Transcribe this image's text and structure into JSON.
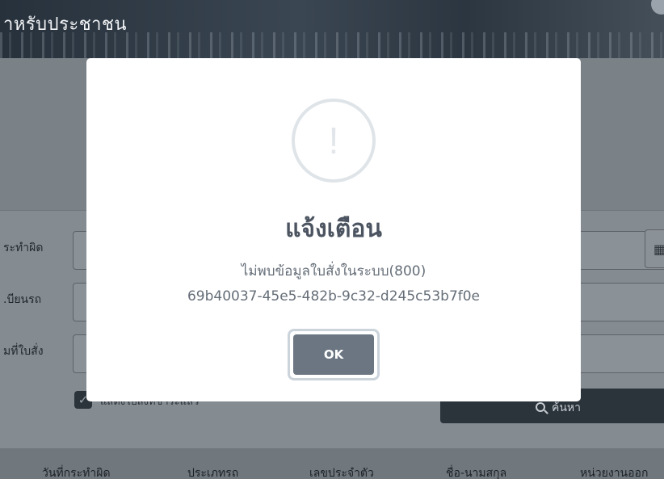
{
  "header": {
    "title": "าหรับประชาชน"
  },
  "form": {
    "labels": [
      "ระทำผิด",
      ".บียนรถ",
      "มที่ใบสั่ง"
    ],
    "checkbox_label": "แสดงใบสั่งที่ชำระแล้ว",
    "search_label": "ค้นหา"
  },
  "table": {
    "columns": [
      "วันที่กระทำผิด",
      "ประเภทรถ",
      "เลขประจำตัว",
      "ชื่อ-นามสกุล",
      "หน่วยงานออก"
    ]
  },
  "modal": {
    "icon": "exclamation-icon",
    "icon_glyph": "!",
    "title": "แจ้งเตือน",
    "message_line1": "ไม่พบข้อมูลใบสั่งในระบบ(800)",
    "message_line2": "69b40037-45e5-482b-9c32-d245c53b7f0e",
    "ok_label": "OK"
  },
  "colors": {
    "ok_button": "#6b7682",
    "title_text": "#4b5460",
    "overlay": "#838a90"
  }
}
